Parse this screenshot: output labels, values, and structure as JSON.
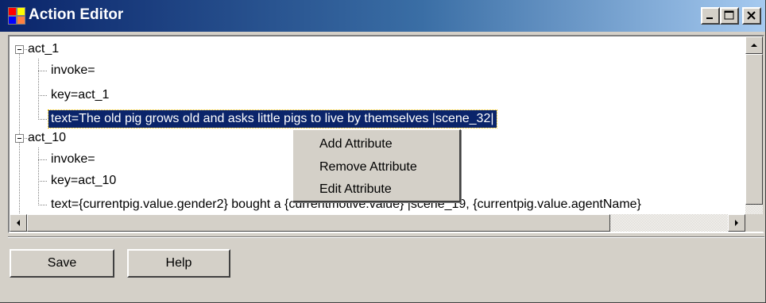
{
  "window": {
    "title": "Action Editor",
    "controls": [
      "minimize",
      "maximize",
      "close"
    ]
  },
  "tree": {
    "nodes": [
      {
        "label": "act_1",
        "expanded": true,
        "children": [
          "invoke=",
          "key=act_1",
          "text=The old pig grows old and asks little pigs to live by themselves |scene_32|"
        ]
      },
      {
        "label": "act_10",
        "expanded": true,
        "children": [
          "invoke=",
          "key=act_10",
          "text={currentpig.value.gender2} bought a {currentmotive.value} |scene_19, {currentpig.value.agentName}"
        ]
      }
    ],
    "selected": "text=The old pig grows old and asks little pigs to live by themselves |scene_32|"
  },
  "context_menu": {
    "items": [
      "Add Attribute",
      "Remove Attribute",
      "Edit Attribute"
    ]
  },
  "buttons": {
    "save": "Save",
    "help": "Help"
  },
  "icons": {
    "app": "app-window-icon",
    "expand": "minus-box-icon",
    "scroll_up": "arrow-up-icon",
    "scroll_left": "arrow-left-icon",
    "scroll_right": "arrow-right-icon"
  },
  "colors": {
    "title_bar": "#0a246a",
    "selection": "#0a246a",
    "face": "#d4d0c8"
  }
}
